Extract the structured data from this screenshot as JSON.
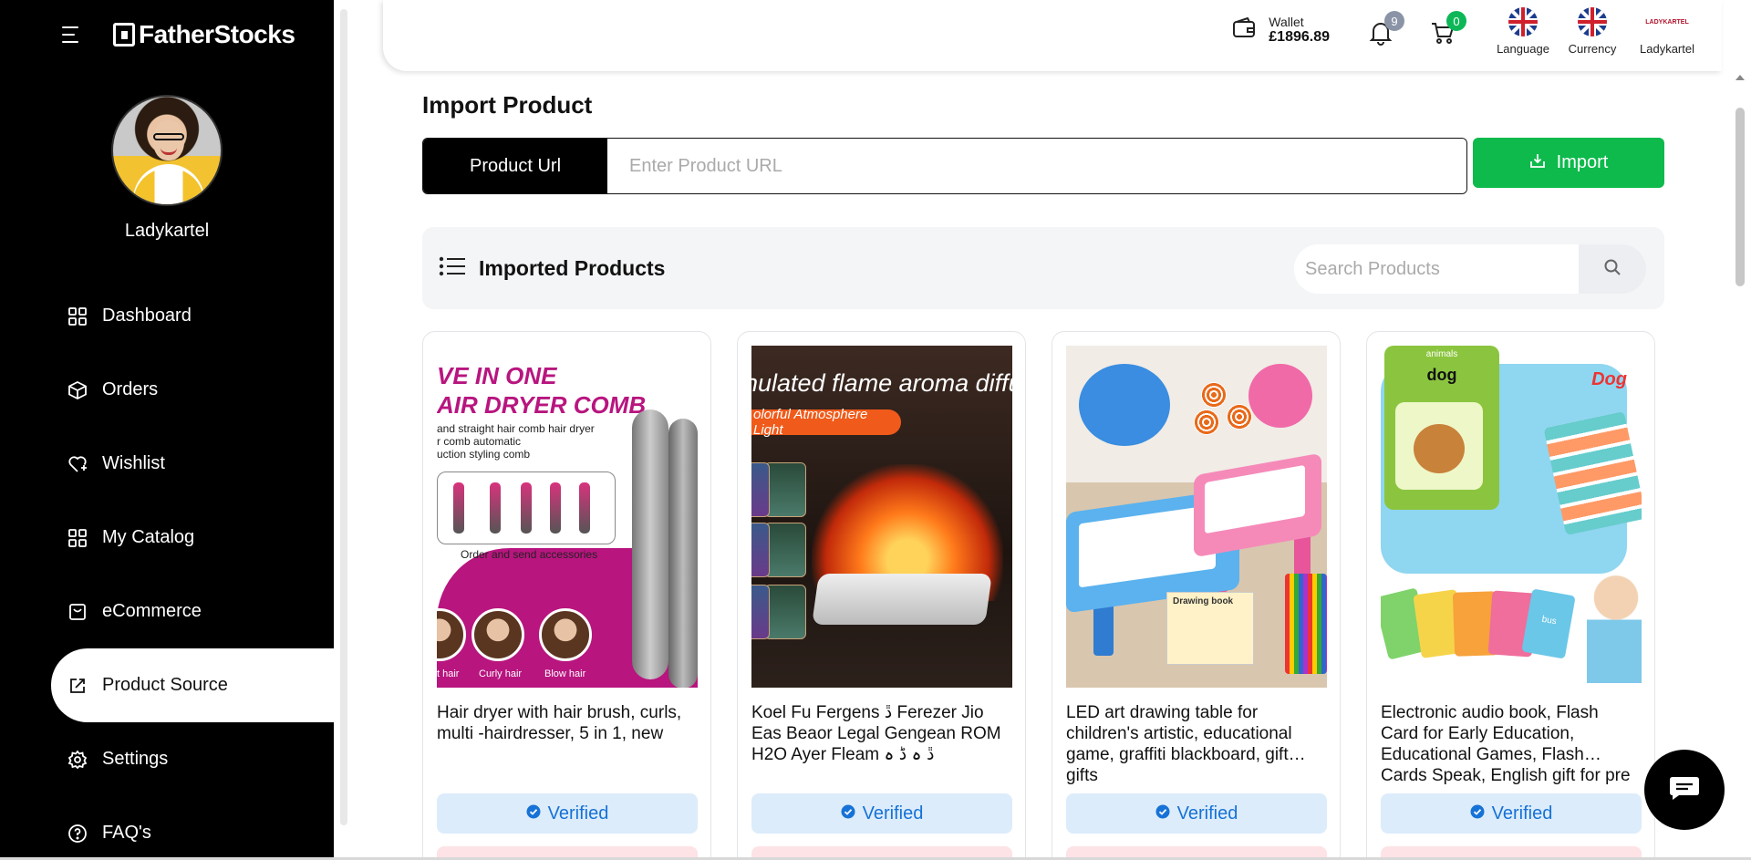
{
  "brand": {
    "name": "FatherStocks"
  },
  "user": {
    "name": "Ladykartel"
  },
  "nav": [
    {
      "label": "Dashboard",
      "icon": "dashboard-icon"
    },
    {
      "label": "Orders",
      "icon": "box-icon"
    },
    {
      "label": "Wishlist",
      "icon": "heart-icon"
    },
    {
      "label": "My Catalog",
      "icon": "grid-icon"
    },
    {
      "label": "eCommerce",
      "icon": "store-icon"
    },
    {
      "label": "Product Source",
      "icon": "edit-icon",
      "active": true
    },
    {
      "label": "Settings",
      "icon": "gear-icon"
    },
    {
      "label": "FAQ's",
      "icon": "help-icon"
    }
  ],
  "header": {
    "wallet_label": "Wallet",
    "wallet_amount": "£1896.89",
    "notifications_count": "9",
    "cart_count": "0",
    "language_label": "Language",
    "currency_label": "Currency",
    "account_label": "Ladykartel",
    "account_logo_text": "LADYKARTEL"
  },
  "import": {
    "title": "Import Product",
    "url_label": "Product Url",
    "url_placeholder": "Enter Product URL",
    "button_label": "Import"
  },
  "imported": {
    "title": "Imported Products",
    "search_placeholder": "Search Products"
  },
  "products": [
    {
      "title": "Hair dryer with hair brush, curls, multi -hairdresser, 5 in 1, new",
      "status": "Verified",
      "image_text": [
        "VE IN ONE",
        "AIR DRYER COMB",
        "and straight hair comb hair dryer\nr comb automatic\nuction styling comb",
        "Order and send accessories",
        "t hair",
        "Curly hair",
        "Blow hair"
      ]
    },
    {
      "title": "Koel Fu Fergens ڐ Ferezer Jio Eas Beaor Legal Gengean ROM H2O Ayer Fleam ڐ ہ ڈ ہ",
      "status": "Verified",
      "image_text": [
        "nulated flame aroma diffuser",
        "olorful Atmosphere Light"
      ]
    },
    {
      "title": "LED art drawing table for children's artistic, educational game, graffiti blackboard, gift… gifts",
      "status": "Verified",
      "image_text": [
        "Drawing book"
      ]
    },
    {
      "title": "Electronic audio book, Flash Card for Early Education, Educational Games, Flash… Cards Speak, English gift for pre",
      "status": "Verified",
      "image_text": [
        "animals",
        "dog",
        "Dog",
        "bus"
      ]
    }
  ],
  "colors": {
    "sidebar_bg": "#000000",
    "import_button": "#0dba4b",
    "verified_bg": "#dcecfb",
    "verified_text": "#1672d6",
    "cart_badge": "#0db757",
    "notification_badge": "#8a94a6"
  }
}
